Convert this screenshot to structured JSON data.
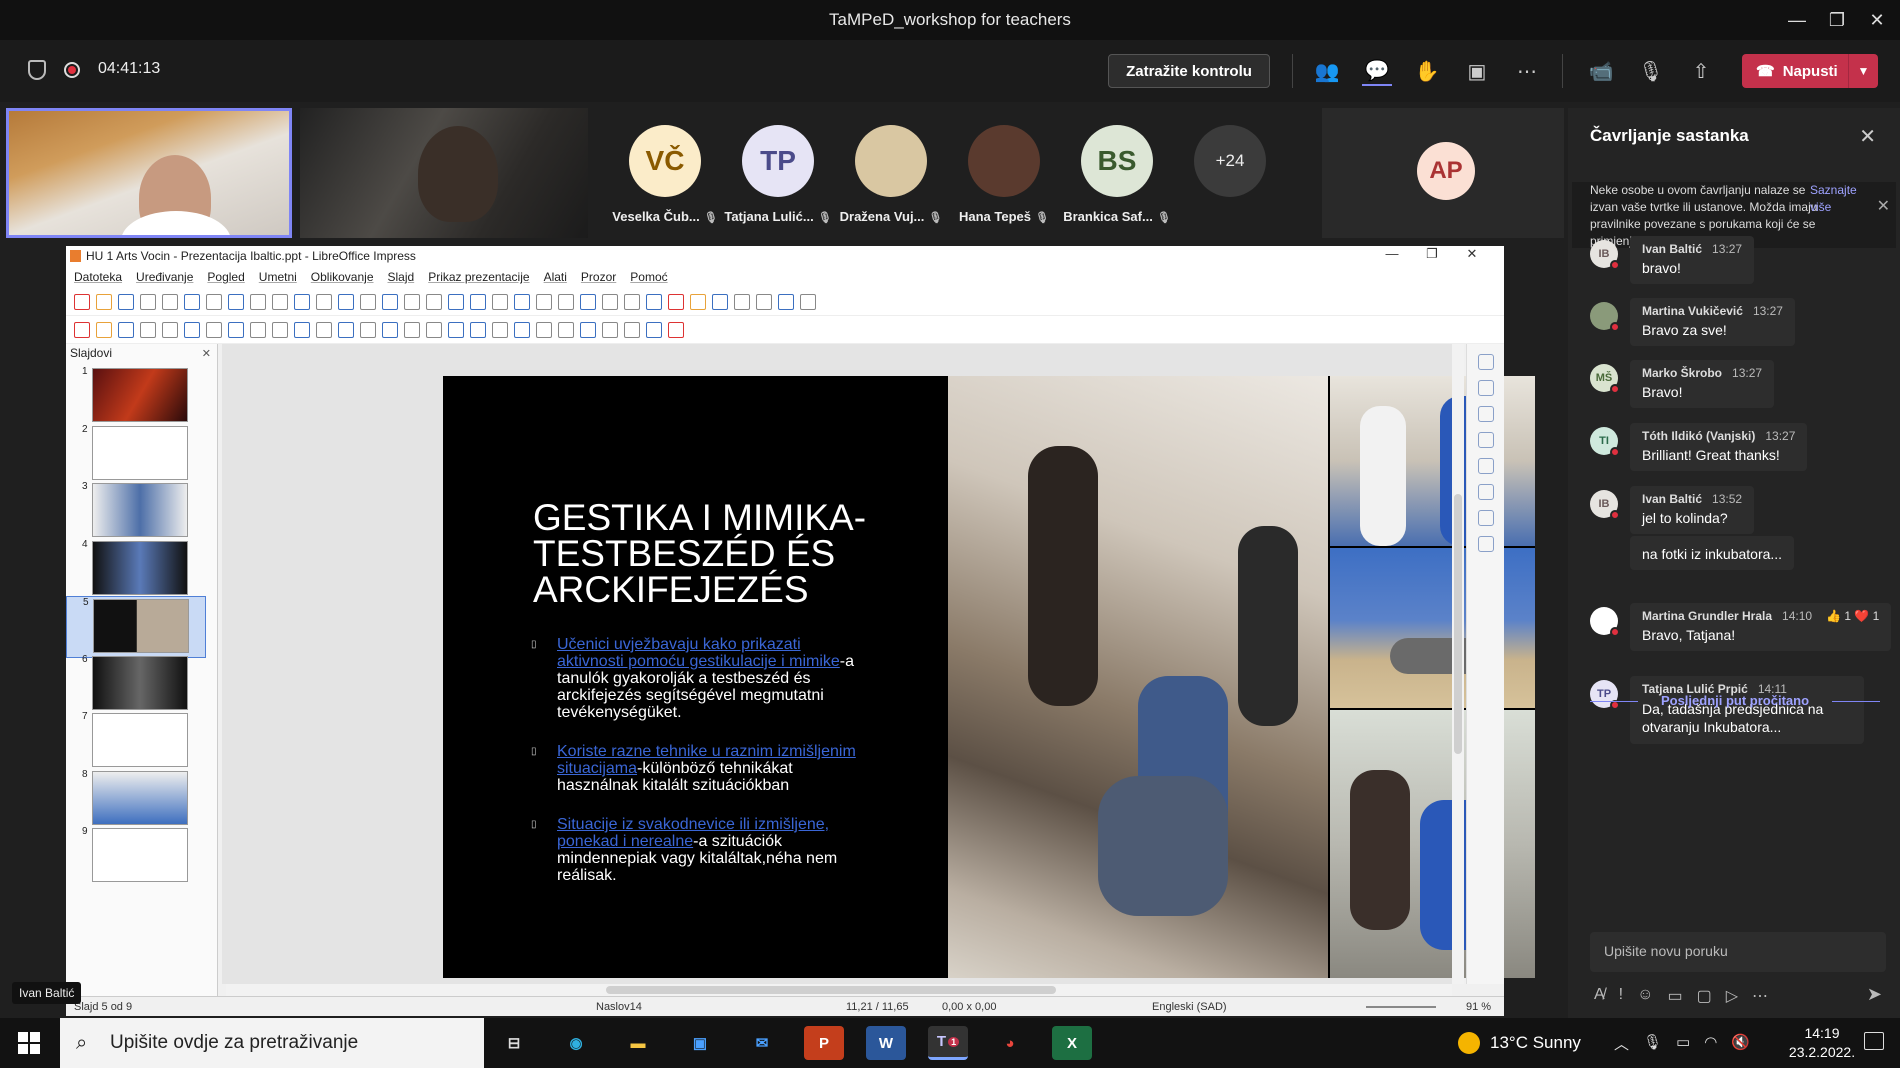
{
  "window": {
    "title": "TaMPeD_workshop for teachers"
  },
  "meeting": {
    "timer": "04:41:13",
    "control_label": "Zatražite kontrolu",
    "leave_label": "Napusti"
  },
  "participants": [
    {
      "initials": "VČ",
      "name": "Veselka Čub...",
      "bg": "#fbecc9",
      "fg": "#8a5a00"
    },
    {
      "initials": "TP",
      "name": "Tatjana Lulić...",
      "bg": "#e6e4f5",
      "fg": "#4b4b8a"
    },
    {
      "initials": "",
      "name": "Dražena Vuj...",
      "bg": "#d9c7a2",
      "fg": "#333"
    },
    {
      "initials": "",
      "name": "Hana Tepeš",
      "bg": "#5a3a2e",
      "fg": "#fff"
    },
    {
      "initials": "BS",
      "name": "Brankica Saf...",
      "bg": "#dde6d6",
      "fg": "#3a5a2e"
    },
    {
      "initials": "+24",
      "name": "",
      "bg": "#3b3b3b",
      "fg": "#eee"
    }
  ],
  "self_avatar": "AP",
  "speaker_label": "Ivan Baltić",
  "lo": {
    "title": "HU 1 Arts Vocin - Prezentacija Ibaltic.ppt - LibreOffice Impress",
    "menu": [
      "Datoteka",
      "Uređivanje",
      "Pogled",
      "Umetni",
      "Oblikovanje",
      "Slajd",
      "Prikaz prezentacije",
      "Alati",
      "Prozor",
      "Pomoć"
    ],
    "slides_label": "Slajdovi",
    "slide_numbers": [
      "1",
      "2",
      "3",
      "4",
      "5",
      "6",
      "7",
      "8",
      "9"
    ],
    "slide": {
      "title_lines": [
        "GESTIKA I MIMIKA-",
        "TESTBESZÉD ÉS",
        "ARCKIFEJEZÉS"
      ],
      "bullets": [
        {
          "link": "Učenici uvježbavaju kako prikazati aktivnosti pomoću gestikulacije i mimike",
          "text": "-a tanulók gyakorolják a testbeszéd  és arckifejezés segítségével megmutatni tevékenységüket."
        },
        {
          "link": "Koriste razne tehnike u raznim izmišljenim situacijama",
          "text": "-különböző tehnikákat használnak kitalált szituációkban"
        },
        {
          "link": "Situacije iz svakodnevice ili izmišljene, ponekad i nerealne",
          "text": "-a szituációk mindennepiak vagy kitaláltak,néha nem reálisak."
        }
      ]
    },
    "status": {
      "slide_of": "Slajd 5 od 9",
      "layout": "Naslov14",
      "position": "11,21 / 11,65",
      "size": "0,00 x 0,00",
      "language": "Engleski (SAD)",
      "zoom": "91 %"
    }
  },
  "chat": {
    "title": "Čavrljanje sastanka",
    "notice": "Neke osobe u ovom čavrljanju nalaze se izvan vaše tvrtke ili ustanove. Možda imaju pravilnike povezane s porukama koji će se primjenjivati na čavrljanje.",
    "learn_more": "Saznajte više",
    "last_read": "Posljednji put pročitano",
    "compose_placeholder": "Upišite novu poruku",
    "messages": [
      {
        "initials": "IB",
        "author": "Ivan Baltić",
        "time": "13:27",
        "text": "bravo!",
        "av_bg": "#e6e4e0",
        "av_fg": "#6a5a5a"
      },
      {
        "initials": "",
        "author": "Martina Vukičević",
        "time": "13:27",
        "text": "Bravo za sve!",
        "av_bg": "#8a9a7a",
        "av_fg": "#fff"
      },
      {
        "initials": "MŠ",
        "author": "Marko Škrobo",
        "time": "13:27",
        "text": "Bravo!",
        "av_bg": "#d9e3cf",
        "av_fg": "#4a6a3a"
      },
      {
        "initials": "TI",
        "author": "Tóth Ildikó (Vanjski)",
        "time": "13:27",
        "text": "Brilliant! Great thanks!",
        "av_bg": "#cfe9dd",
        "av_fg": "#2a6a4a"
      },
      {
        "initials": "IB",
        "author": "Ivan Baltić",
        "time": "13:52",
        "text": "jel to kolinda?",
        "av_bg": "#e6e4e0",
        "av_fg": "#6a5a5a"
      },
      {
        "initials": "",
        "author": "",
        "time": "",
        "text": "na fotki iz inkubatora...",
        "av_bg": "",
        "av_fg": ""
      },
      {
        "initials": "",
        "author": "Martina Grundler Hrala",
        "time": "14:10",
        "text": "Bravo, Tatjana!",
        "av_bg": "#fff",
        "av_fg": "#222",
        "reactions": "👍 1  ❤️ 1"
      },
      {
        "initials": "TP",
        "author": "Tatjana Lulić Prpić",
        "time": "14:11",
        "text": "Da, tadašnja predsjednica na otvaranju Inkubatora...",
        "av_bg": "#e6e4f5",
        "av_fg": "#4b4b8a"
      }
    ]
  },
  "taskbar": {
    "search_placeholder": "Upišite ovdje za pretraživanje",
    "weather": "13°C  Sunny",
    "time": "14:19",
    "date": "23.2.2022.",
    "teams_badge": "1"
  }
}
